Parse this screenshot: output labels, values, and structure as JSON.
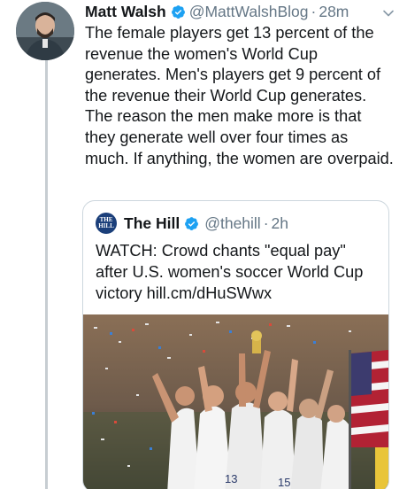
{
  "tweet": {
    "author_name": "Matt Walsh",
    "handle": "@MattWalshBlog",
    "separator": "·",
    "time": "28m",
    "text": "The female players get 13 percent of the revenue the women's World Cup generates. Men's players get 9 percent of the revenue their World Cup generates. The reason the men make more is that they generate well over four times as much. If anything, the women are overpaid."
  },
  "quoted_tweet": {
    "author_name": "The Hill",
    "handle": "@thehill",
    "separator": "·",
    "time": "2h",
    "text": "WATCH: Crowd chants \"equal pay\" after U.S. women's soccer World Cup victory hill.cm/dHuSWwx",
    "media_alt_kind": "photo"
  },
  "colors": {
    "verified_blue": "#1da1f2",
    "secondary_text": "#657786",
    "thread_line": "#c7cdd2",
    "quote_border": "#ccd6dd"
  },
  "icons": [
    "verified-badge-icon",
    "chevron-down-icon",
    "the-hill-logo"
  ]
}
